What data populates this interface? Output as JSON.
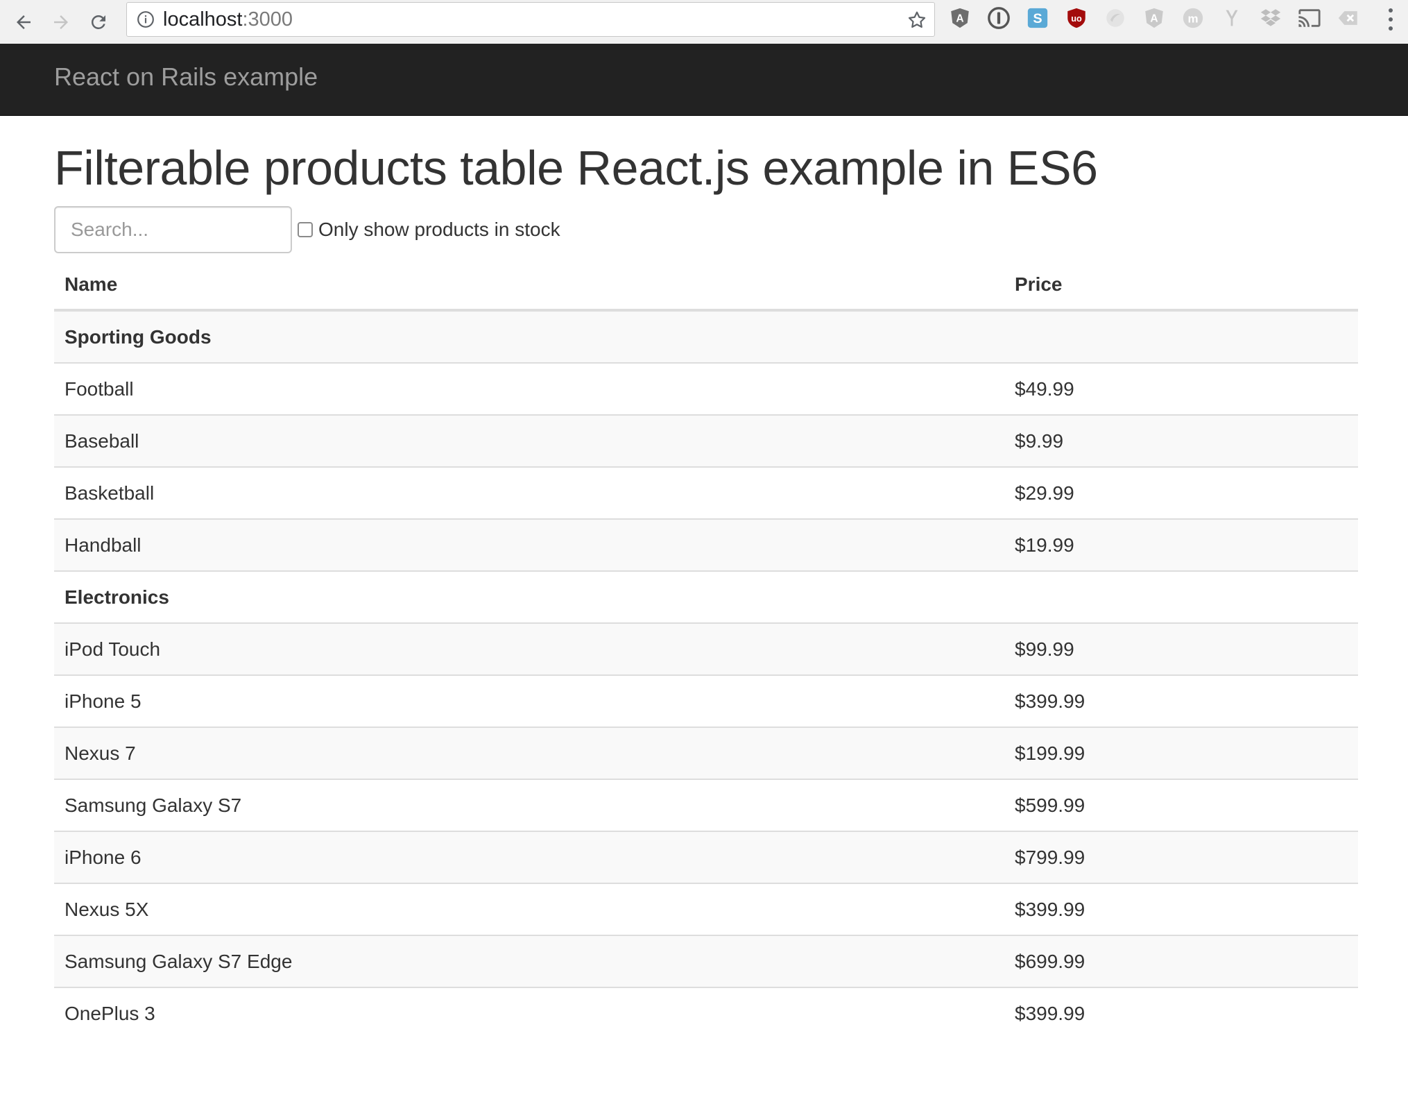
{
  "browser": {
    "url_host": "localhost",
    "url_port": ":3000",
    "extensions": [
      "angular-shield-icon",
      "onepassword-icon",
      "skype-icon",
      "ublock-icon",
      "chrome-extension-icon",
      "angular-icon",
      "m-extension-icon",
      "wappalyzer-icon",
      "dropbox-icon",
      "cast-icon",
      "clear-cache-icon"
    ]
  },
  "navbar": {
    "brand": "React on Rails example"
  },
  "page": {
    "title": "Filterable products table React.js example in ES6"
  },
  "search": {
    "placeholder": "Search...",
    "value": "",
    "stock_only_label": "Only show products in stock",
    "stock_only_checked": false
  },
  "table": {
    "headers": {
      "name": "Name",
      "price": "Price"
    },
    "categories": [
      {
        "name": "Sporting Goods",
        "products": [
          {
            "name": "Football",
            "price": "$49.99",
            "stocked": true
          },
          {
            "name": "Baseball",
            "price": "$9.99",
            "stocked": true
          },
          {
            "name": "Basketball",
            "price": "$29.99",
            "stocked": false
          },
          {
            "name": "Handball",
            "price": "$19.99",
            "stocked": false
          }
        ]
      },
      {
        "name": "Electronics",
        "products": [
          {
            "name": "iPod Touch",
            "price": "$99.99",
            "stocked": true
          },
          {
            "name": "iPhone 5",
            "price": "$399.99",
            "stocked": false
          },
          {
            "name": "Nexus 7",
            "price": "$199.99",
            "stocked": true
          },
          {
            "name": "Samsung Galaxy S7",
            "price": "$599.99",
            "stocked": false
          },
          {
            "name": "iPhone 6",
            "price": "$799.99",
            "stocked": false
          },
          {
            "name": "Nexus 5X",
            "price": "$399.99",
            "stocked": true
          },
          {
            "name": "Samsung Galaxy S7 Edge",
            "price": "$699.99",
            "stocked": true
          },
          {
            "name": "OnePlus 3",
            "price": "$399.99",
            "stocked": true
          }
        ]
      }
    ]
  },
  "colors": {
    "navbar_bg": "#222222",
    "brand_text": "#9d9d9d",
    "out_of_stock": "#ff0000",
    "striped_row": "#f9f9f9"
  }
}
